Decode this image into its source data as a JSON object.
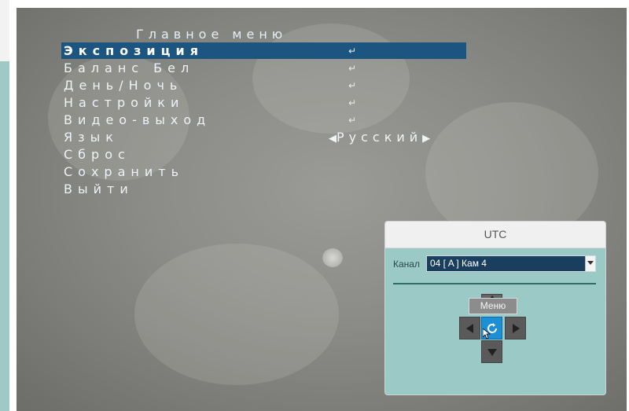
{
  "osd": {
    "title": "Главное меню",
    "items": [
      {
        "label": "Экспозиция",
        "selected": true,
        "enter": "↵"
      },
      {
        "label": "Баланс Бел",
        "enter": "↵"
      },
      {
        "label": "День/Ночь",
        "enter": "↵"
      },
      {
        "label": "Настройки",
        "enter": "↵"
      },
      {
        "label": "Видео-выход",
        "enter": "↵"
      },
      {
        "label": "Язык",
        "value": "Русский"
      },
      {
        "label": "Сброс"
      },
      {
        "label": "Сохранить"
      },
      {
        "label": "Выйти"
      }
    ]
  },
  "ptz": {
    "title": "UTC",
    "channel_label": "Канал",
    "channel_value": "04 [ A ] Кам 4",
    "menu_tooltip": "Меню",
    "icons": [
      "arrow-up-icon",
      "arrow-left-icon",
      "arrow-right-icon",
      "arrow-down-icon",
      "refresh-icon",
      "dropdown-arrow-icon",
      "mouse-cursor-icon"
    ]
  },
  "colors": {
    "menu_highlight": "#1b5580",
    "panel_bg": "#9bc9c5",
    "center_button": "#1c8fd6"
  }
}
